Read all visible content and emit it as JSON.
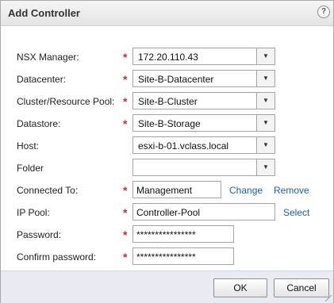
{
  "dialog": {
    "title": "Add Controller",
    "help_symbol": "?"
  },
  "form": {
    "nsx_manager": {
      "label": "NSX Manager:",
      "required": "*",
      "value": "172.20.110.43"
    },
    "datacenter": {
      "label": "Datacenter:",
      "required": "*",
      "value": "Site-B-Datacenter"
    },
    "cluster": {
      "label": "Cluster/Resource Pool:",
      "required": "*",
      "value": "Site-B-Cluster"
    },
    "datastore": {
      "label": "Datastore:",
      "required": "*",
      "value": "Site-B-Storage"
    },
    "host": {
      "label": "Host:",
      "value": "esxi-b-01.vclass.local"
    },
    "folder": {
      "label": "Folder",
      "value": ""
    },
    "connected_to": {
      "label": "Connected To:",
      "required": "*",
      "value": "Management",
      "change_label": "Change",
      "remove_label": "Remove"
    },
    "ip_pool": {
      "label": "IP Pool:",
      "required": "*",
      "value": "Controller-Pool",
      "select_label": "Select"
    },
    "password": {
      "label": "Password:",
      "required": "*",
      "value": "****************"
    },
    "confirm_password": {
      "label": "Confirm password:",
      "required": "*",
      "value": "****************"
    }
  },
  "footer": {
    "ok_label": "OK",
    "cancel_label": "Cancel"
  },
  "icons": {
    "dropdown_arrow": "chevron-down-icon",
    "help": "help-icon",
    "resize": "resize-grip-icon"
  }
}
